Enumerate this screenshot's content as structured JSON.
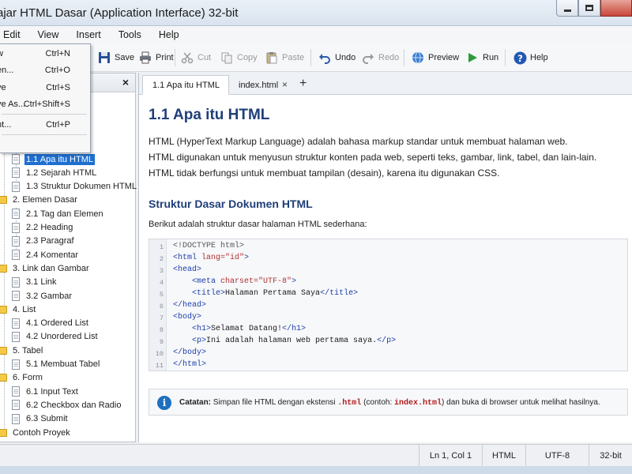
{
  "window": {
    "title": "ajar HTML Dasar (Application Interface) 32-bit"
  },
  "menubar": [
    "Edit",
    "View",
    "Insert",
    "Tools",
    "Help"
  ],
  "file_menu": {
    "items": [
      {
        "label": "w",
        "shortcut": "Ctrl+N"
      },
      {
        "label": "en...",
        "shortcut": "Ctrl+O"
      },
      {
        "label": "ve",
        "shortcut": "Ctrl+S"
      },
      {
        "label": "ve As...",
        "shortcut": "Ctrl+Shift+S"
      },
      {
        "label": "nt...",
        "shortcut": "Ctrl+P"
      },
      {
        "label": "t",
        "shortcut": ""
      }
    ]
  },
  "toolbar": {
    "save": "Save",
    "print": "Print",
    "cut": "Cut",
    "copy": "Copy",
    "paste": "Paste",
    "undo": "Undo",
    "redo": "Redo",
    "preview": "Preview",
    "run": "Run",
    "help": "Help"
  },
  "panel": {
    "close": "×"
  },
  "tree": [
    {
      "label": "1.1 Apa itu HTML",
      "type": "doc",
      "selected": true
    },
    {
      "label": "1.2 Sejarah HTML",
      "type": "doc"
    },
    {
      "label": "1.3 Struktur Dokumen HTML",
      "type": "doc"
    },
    {
      "label": "2. Elemen Dasar",
      "type": "folder"
    },
    {
      "label": "2.1 Tag dan Elemen",
      "type": "doc"
    },
    {
      "label": "2.2 Heading",
      "type": "doc"
    },
    {
      "label": "2.3 Paragraf",
      "type": "doc"
    },
    {
      "label": "2.4 Komentar",
      "type": "doc"
    },
    {
      "label": "3. Link dan Gambar",
      "type": "folder"
    },
    {
      "label": "3.1 Link",
      "type": "doc"
    },
    {
      "label": "3.2 Gambar",
      "type": "doc"
    },
    {
      "label": "4. List",
      "type": "folder"
    },
    {
      "label": "4.1 Ordered List",
      "type": "doc"
    },
    {
      "label": "4.2 Unordered List",
      "type": "doc"
    },
    {
      "label": "5. Tabel",
      "type": "folder"
    },
    {
      "label": "5.1 Membuat Tabel",
      "type": "doc"
    },
    {
      "label": "6. Form",
      "type": "folder"
    },
    {
      "label": "6.1 Input Text",
      "type": "doc"
    },
    {
      "label": "6.2 Checkbox dan Radio",
      "type": "doc"
    },
    {
      "label": "6.3 Submit",
      "type": "doc"
    },
    {
      "label": "Contoh Proyek",
      "type": "folder"
    }
  ],
  "tabs": [
    {
      "label": "1.1 Apa itu HTML",
      "close": "×"
    },
    {
      "label": "index.html",
      "close": "×"
    }
  ],
  "tab_add": "+",
  "content": {
    "heading": "1.1 Apa itu HTML",
    "paragraphs": [
      "HTML (HyperText Markup Language) adalah bahasa markup standar untuk membuat halaman web.",
      "HTML digunakan untuk menyusun struktur konten pada web, seperti teks, gambar, link, tabel, dan lain-lain.",
      "HTML tidak berfungsi untuk membuat tampilan (desain), karena itu digunakan CSS."
    ],
    "subheading": "Struktur Dasar Dokumen HTML",
    "intro": "Berikut adalah struktur dasar halaman HTML sederhana:",
    "code_line_numbers": [
      "1",
      "2",
      "3",
      "4",
      "5",
      "6",
      "7",
      "8",
      "9",
      "10",
      "11"
    ],
    "code": {
      "l1": "<!DOCTYPE html>",
      "l2_open": "<html ",
      "l2_attr": "lang=",
      "l2_val": "\"id\"",
      "l2_close": ">",
      "l3": "<head>",
      "l4_open": "<meta ",
      "l4_attr": "charset=",
      "l4_val": "\"UTF-8\"",
      "l4_close": ">",
      "l5_open": "<title>",
      "l5_text": "Halaman Pertama Saya",
      "l5_close": "</title>",
      "l6": "</head>",
      "l7": "<body>",
      "l8_open": "<h1>",
      "l8_text": "Selamat Datang!",
      "l8_close": "</h1>",
      "l9_open": "<p>",
      "l9_text": "Ini adalah halaman web pertama saya.",
      "l9_close": "</p>",
      "l10": "</body>",
      "l11": "</html>"
    },
    "note": {
      "label": "Catatan:",
      "text1": "Simpan file HTML dengan ekstensi",
      "ext": ".html",
      "text2": "(contoh:",
      "example": "index.html",
      "text3": ") dan buka di browser untuk melihat hasilnya."
    }
  },
  "statusbar": {
    "position": "Ln 1, Col 1",
    "language": "HTML",
    "encoding": "UTF-8",
    "arch": "32-bit"
  },
  "colors": {
    "selection": "#1f6fd1",
    "heading": "#1f3f7a",
    "code_tag": "#1a3ea8",
    "code_attr": "#b03030",
    "info": "#1e6fbf"
  }
}
